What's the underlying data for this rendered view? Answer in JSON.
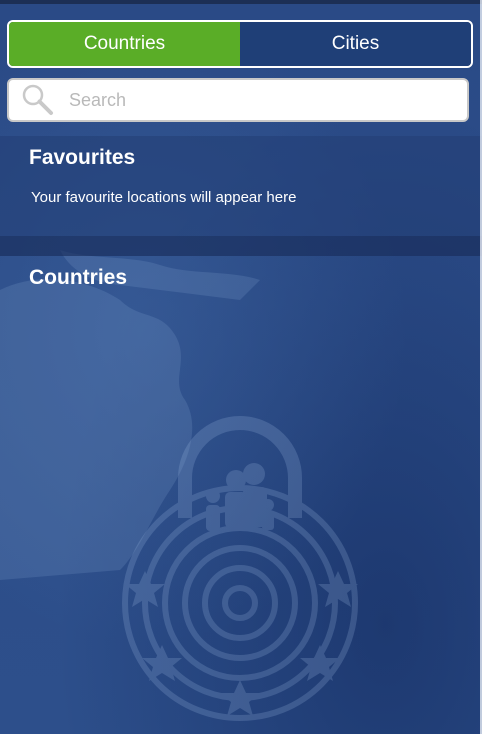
{
  "segment": {
    "tabs": [
      {
        "label": "Countries",
        "active": true
      },
      {
        "label": "Cities",
        "active": false
      }
    ]
  },
  "search": {
    "placeholder": "Search"
  },
  "favourites": {
    "title": "Favourites",
    "empty_message": "Your favourite locations will appear here"
  },
  "countries": {
    "title": "Countries"
  },
  "colors": {
    "active_tab": "#5aad27",
    "inactive_tab": "#1f3f77",
    "background": "#2b4b86"
  }
}
